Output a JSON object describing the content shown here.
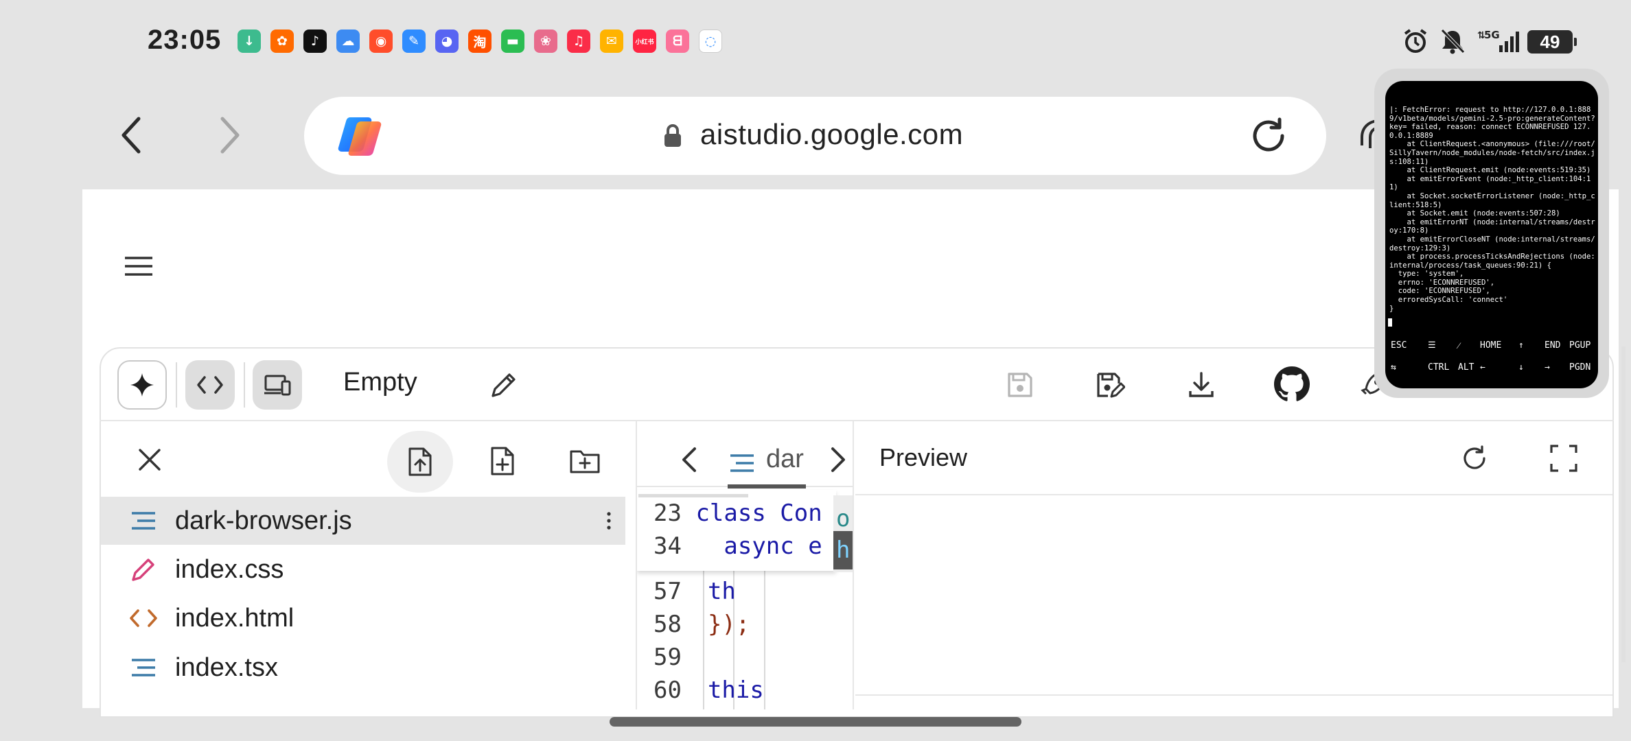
{
  "status_bar": {
    "time": "23:05",
    "battery": "49",
    "network": "5G",
    "notifications": [
      {
        "name": "download-icon",
        "glyph": "↓",
        "color": "#3dbb8e"
      },
      {
        "name": "app-icon",
        "glyph": "✿",
        "color": "#ff6a00"
      },
      {
        "name": "tiktok-icon",
        "glyph": "♪",
        "color": "#111111"
      },
      {
        "name": "weather-icon",
        "glyph": "☁",
        "color": "#3d8bf2"
      },
      {
        "name": "app-icon",
        "glyph": "◉",
        "color": "#ff4d2a"
      },
      {
        "name": "feather-icon",
        "glyph": "✎",
        "color": "#2f8cff"
      },
      {
        "name": "discord-icon",
        "glyph": "◕",
        "color": "#5865f2"
      },
      {
        "name": "taobao-icon",
        "glyph": "淘",
        "color": "#ff5000"
      },
      {
        "name": "messages-icon",
        "glyph": "▬",
        "color": "#2bbd52"
      },
      {
        "name": "gallery-icon",
        "glyph": "❀",
        "color": "#e86b8c"
      },
      {
        "name": "music-icon",
        "glyph": "♫",
        "color": "#fa2d48"
      },
      {
        "name": "mail-icon",
        "glyph": "✉",
        "color": "#ffb300"
      },
      {
        "name": "xiaohongshu-icon",
        "glyph": "小红书",
        "color": "#ff2442"
      },
      {
        "name": "bilibili-icon",
        "glyph": "ᗺ",
        "color": "#fb7299"
      },
      {
        "name": "chat-icon",
        "glyph": "◌",
        "color": "#ffffff"
      }
    ]
  },
  "browser": {
    "url": "aistudio.google.com"
  },
  "toolbar": {
    "project_name": "Empty"
  },
  "explorer": {
    "files": [
      {
        "name": "dark-browser.js",
        "type": "js",
        "selected": true
      },
      {
        "name": "index.css",
        "type": "css"
      },
      {
        "name": "index.html",
        "type": "html"
      },
      {
        "name": "index.tsx",
        "type": "tsx"
      }
    ]
  },
  "editor": {
    "tab_label": "dar",
    "sticky": [
      {
        "ln": "23",
        "code": "class Con"
      },
      {
        "ln": "34",
        "code": "  async e"
      }
    ],
    "lines": [
      {
        "ln": "57",
        "code": "th"
      },
      {
        "ln": "58",
        "code": "});"
      },
      {
        "ln": "59",
        "code": ""
      },
      {
        "ln": "60",
        "code": "this"
      }
    ],
    "peek": [
      "o",
      "h"
    ]
  },
  "preview": {
    "title": "Preview"
  },
  "terminal": {
    "log": "|: FetchError: request to http://127.0.0.1:8889/v1beta/models/gemini-2.5-pro:generateContent?key= failed, reason: connect ECONNREFUSED 127.0.0.1:8889\n    at ClientRequest.<anonymous> (file:///root/SillyTavern/node_modules/node-fetch/src/index.js:108:11)\n    at ClientRequest.emit (node:events:519:35)\n    at emitErrorEvent (node:_http_client:104:11)\n    at Socket.socketErrorListener (node:_http_client:518:5)\n    at Socket.emit (node:events:507:28)\n    at emitErrorNT (node:internal/streams/destroy:170:8)\n    at emitErrorCloseNT (node:internal/streams/destroy:129:3)\n    at process.processTicksAndRejections (node:internal/process/task_queues:90:21) {\n  type: 'system',\n  errno: 'ECONNREFUSED',\n  code: 'ECONNREFUSED',\n  erroredSysCall: 'connect'\n}",
    "keys_row1": [
      "ESC",
      "☰",
      "⁄",
      "HOME",
      "↑",
      "END",
      "PGUP"
    ],
    "keys_row2": [
      "⇆",
      "CTRL",
      "ALT",
      "←",
      "↓",
      "→",
      "PGDN"
    ]
  }
}
